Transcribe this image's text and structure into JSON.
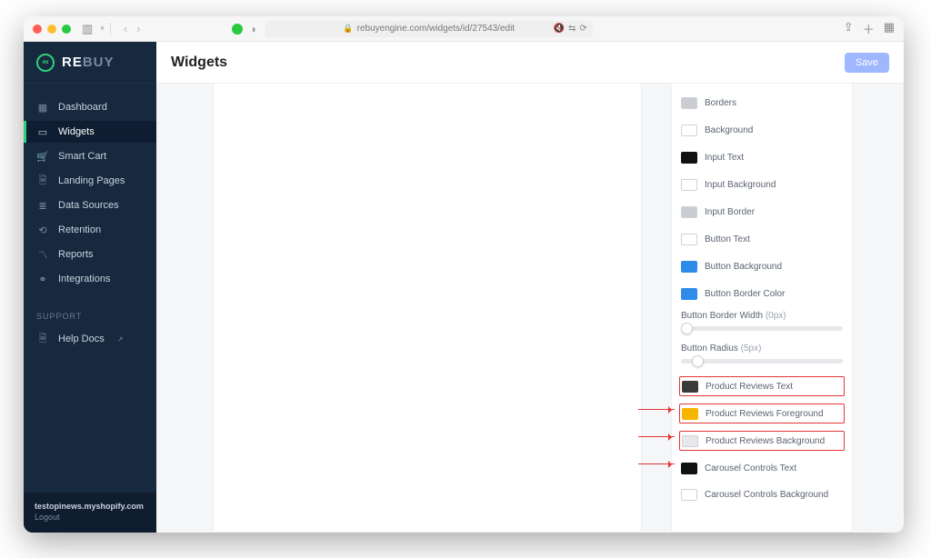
{
  "browser": {
    "url": "rebuyengine.com/widgets/id/27543/edit"
  },
  "sidebar": {
    "brand_prefix": "RE",
    "brand_suffix": "BUY",
    "items": [
      {
        "label": "Dashboard",
        "icon": "grid-icon"
      },
      {
        "label": "Widgets",
        "icon": "box-icon"
      },
      {
        "label": "Smart Cart",
        "icon": "cart-icon"
      },
      {
        "label": "Landing Pages",
        "icon": "page-icon"
      },
      {
        "label": "Data Sources",
        "icon": "list-icon"
      },
      {
        "label": "Retention",
        "icon": "refresh-icon"
      },
      {
        "label": "Reports",
        "icon": "trend-icon"
      },
      {
        "label": "Integrations",
        "icon": "link-icon"
      }
    ],
    "support_label": "SUPPORT",
    "help_docs": "Help Docs",
    "shop_domain": "testopinews.myshopify.com",
    "logout": "Logout"
  },
  "topbar": {
    "title": "Widgets",
    "save_label": "Save"
  },
  "inspector": {
    "rows": [
      {
        "label": "Borders",
        "swatch": "#c9ccd0"
      },
      {
        "label": "Background",
        "swatch": "#ffffff"
      },
      {
        "label": "Input Text",
        "swatch": "#111111"
      },
      {
        "label": "Input Background",
        "swatch": "#ffffff"
      },
      {
        "label": "Input Border",
        "swatch": "#c9ccd0"
      },
      {
        "label": "Button Text",
        "swatch": "#ffffff"
      },
      {
        "label": "Button Background",
        "swatch": "#2f8bea"
      },
      {
        "label": "Button Border Color",
        "swatch": "#2f8bea"
      }
    ],
    "slider1_label": "Button Border Width",
    "slider1_value": "(0px)",
    "slider2_label": "Button Radius",
    "slider2_value": "(5px)",
    "highlight_rows": [
      {
        "label": "Product Reviews Text",
        "swatch": "#3a3a3a"
      },
      {
        "label": "Product Reviews Foreground",
        "swatch": "#f7b500"
      },
      {
        "label": "Product Reviews Background",
        "swatch": "#e6e8eb"
      }
    ],
    "tail_rows": [
      {
        "label": "Carousel Controls Text",
        "swatch": "#111111"
      },
      {
        "label": "Carousel Controls Background",
        "swatch": "#ffffff"
      }
    ]
  }
}
